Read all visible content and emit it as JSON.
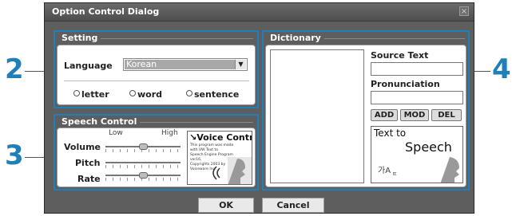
{
  "callouts": [
    "2",
    "3",
    "4"
  ],
  "window": {
    "title": "Option Control Dialog",
    "close_glyph": "×"
  },
  "setting": {
    "title": "Setting",
    "language_label": "Language",
    "language_value": "Korean",
    "radios": [
      "letter",
      "word",
      "sentence"
    ]
  },
  "speech": {
    "title": "Speech Control",
    "low_label": "Low",
    "high_label": "High",
    "sliders": [
      {
        "label": "Volume",
        "level": 0.5
      },
      {
        "label": "Pitch",
        "level": null
      },
      {
        "label": "Rate",
        "level": 0.5
      }
    ],
    "voice_panel": {
      "title": "Voice Control",
      "body_lines": [
        "This program was made with VW Text to",
        "Speech Engine Program ver16,",
        "Copyrights 2003 by",
        "Voiceware Inc."
      ]
    }
  },
  "dictionary": {
    "title": "Dictionary",
    "source_label": "Source Text",
    "source_value": "",
    "pron_label": "Pronunciation",
    "pron_value": "",
    "buttons": [
      "ADD",
      "MOD",
      "DEL"
    ],
    "tts_line1": "Text to",
    "tts_line2": "Speech",
    "tts_glyphs": "가A",
    "tts_glyph_small": "ㄸ"
  },
  "footer": {
    "ok": "OK",
    "cancel": "Cancel"
  },
  "colors": {
    "accent": "#1f7fb8",
    "frame": "#5e5e5e"
  },
  "icons": {
    "close": "close-icon",
    "dropdown": "chevron-down-icon",
    "speaker": "speaker-icon"
  }
}
